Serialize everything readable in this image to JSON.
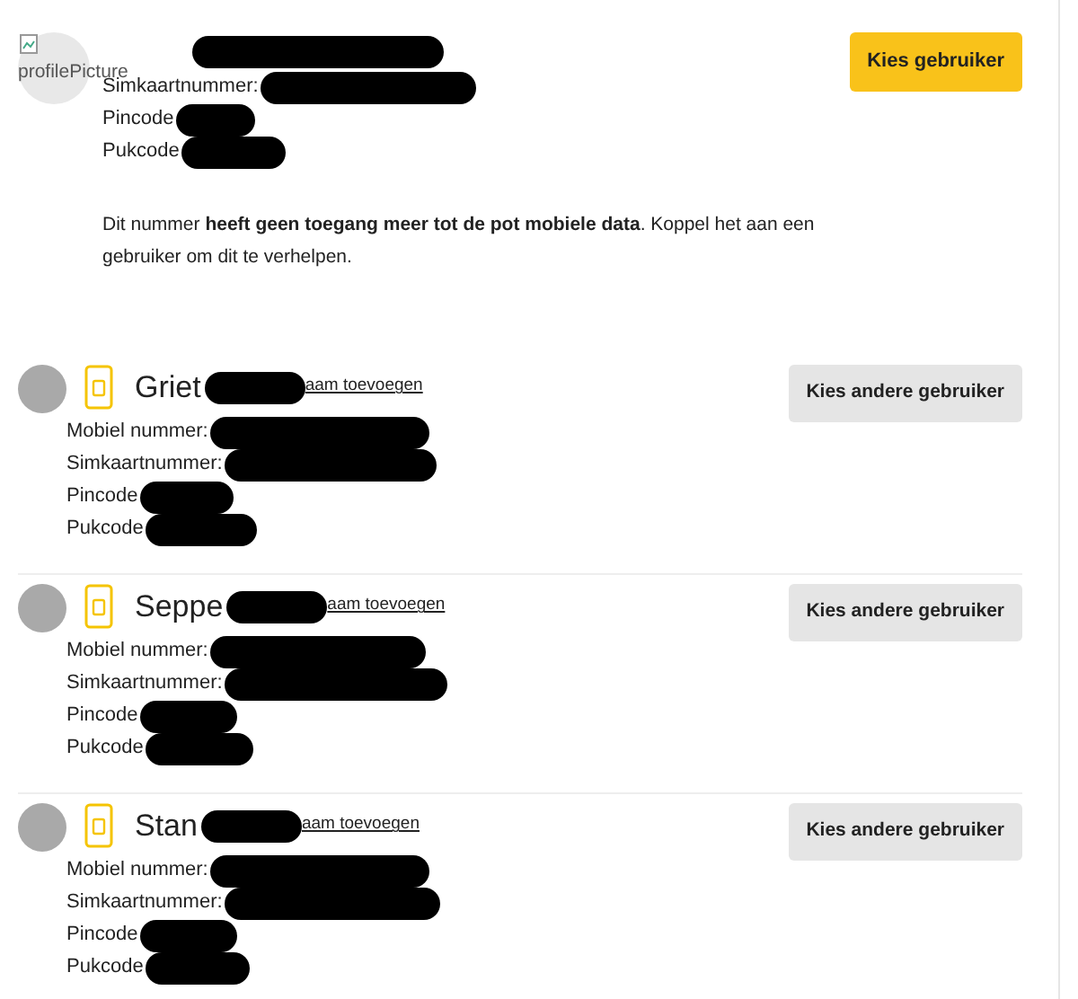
{
  "entries": [
    {
      "kind": "current",
      "avatar_alt": "profilePicture",
      "fields": [
        "Simkaartnummer:",
        "Pincode",
        "Pukcode"
      ],
      "message": "Dit nummer **heeft geen toegang meer tot de pot mobiele data**. Koppel het aan een gebruiker om dit te verhelpen.",
      "button": "Kies gebruiker"
    },
    {
      "kind": "other",
      "name": "Griet",
      "link": "aam toevoegen",
      "fields": [
        "Mobiel nummer:",
        "Simkaartnummer:",
        "Pincode",
        "Pukcode"
      ],
      "button": "Kies andere gebruiker"
    },
    {
      "kind": "other",
      "name": "Seppe",
      "link": "aam toevoegen",
      "fields": [
        "Mobiel nummer:",
        "Simkaartnummer:",
        "Pincode",
        "Pukcode"
      ],
      "button": "Kies andere gebruiker"
    },
    {
      "kind": "other",
      "name": "Stan",
      "link": "aam toevoegen",
      "fields": [
        "Mobiel nummer:",
        "Simkaartnummer:",
        "Pincode",
        "Pukcode"
      ],
      "button": "Kies andere gebruiker"
    }
  ]
}
